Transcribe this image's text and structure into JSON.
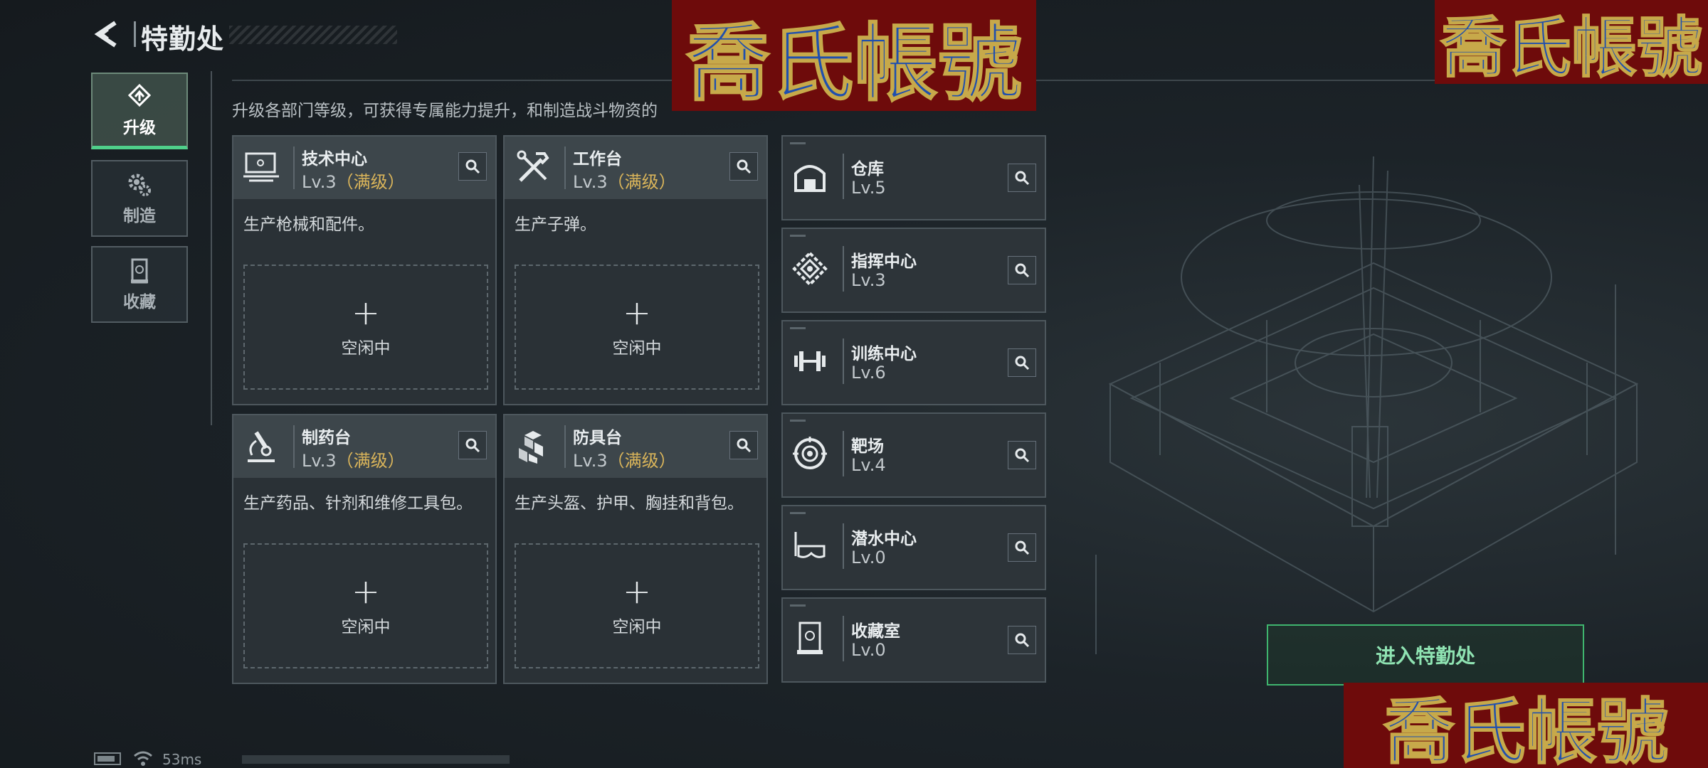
{
  "header": {
    "title": "特勤处"
  },
  "nav": [
    {
      "label": "升级",
      "icon": "upgrade-icon",
      "active": true
    },
    {
      "label": "制造",
      "icon": "gear-icon",
      "active": false
    },
    {
      "label": "收藏",
      "icon": "collection-icon",
      "active": false
    }
  ],
  "description": "升级各部门等级，可获得专属能力提升，和制造战斗物资的",
  "main_cards": [
    {
      "name": "技术中心",
      "level": "Lv.3",
      "max": "（满级）",
      "desc": "生产枪械和配件。",
      "plus": "+",
      "status": "空闲中",
      "icon": "workstation-icon"
    },
    {
      "name": "工作台",
      "level": "Lv.3",
      "max": "（满级）",
      "desc": "生产子弹。",
      "plus": "+",
      "status": "空闲中",
      "icon": "tools-icon"
    },
    {
      "name": "制药台",
      "level": "Lv.3",
      "max": "（满级）",
      "desc": "生产药品、针剂和维修工具包。",
      "plus": "+",
      "status": "空闲中",
      "icon": "microscope-icon"
    },
    {
      "name": "防具台",
      "level": "Lv.3",
      "max": "（满级）",
      "desc": "生产头盔、护甲、胸挂和背包。",
      "plus": "+",
      "status": "空闲中",
      "icon": "armor-icon"
    }
  ],
  "side_cards": [
    {
      "name": "仓库",
      "level": "Lv.5",
      "icon": "warehouse-icon"
    },
    {
      "name": "指挥中心",
      "level": "Lv.3",
      "icon": "command-icon"
    },
    {
      "name": "训练中心",
      "level": "Lv.6",
      "icon": "dumbbell-icon"
    },
    {
      "name": "靶场",
      "level": "Lv.4",
      "icon": "target-icon"
    },
    {
      "name": "潜水中心",
      "level": "Lv.0",
      "icon": "diving-mask-icon"
    },
    {
      "name": "收藏室",
      "level": "Lv.0",
      "icon": "display-case-icon"
    }
  ],
  "enter_button": "进入特勤处",
  "watermark": "喬氏帳號",
  "network": {
    "ping": "53ms"
  },
  "colors": {
    "accent": "#4fd08a",
    "max_level": "#d9b45a",
    "watermark_bg": "#6e0b0b"
  }
}
